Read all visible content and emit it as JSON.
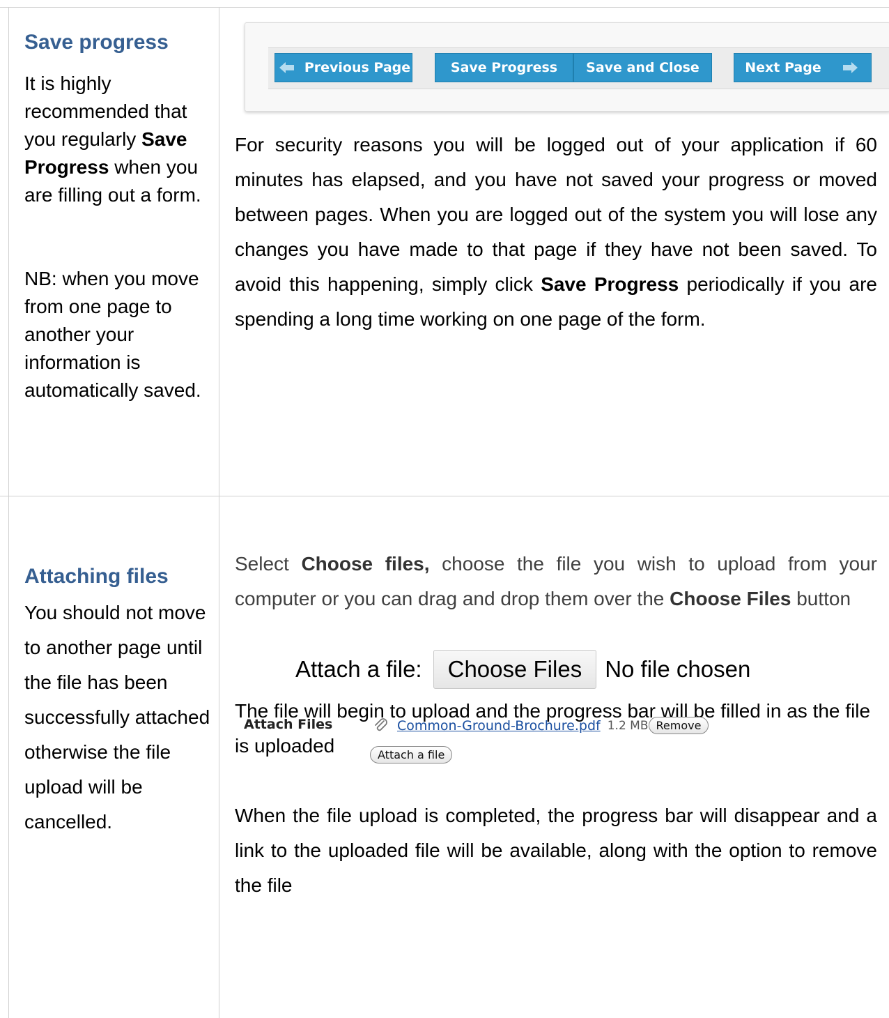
{
  "section1": {
    "heading": "Save progress",
    "side_text_a": "It is highly recommended that you regularly",
    "side_text_bold": "Save Progress",
    "side_text_b": "when you are filling out a form.",
    "side_note": "NB: when you move from one page to another your information is automatically saved.",
    "nav": {
      "prev_label": "Previous Page",
      "save_label": "Save Progress",
      "save_close_label": "Save and Close",
      "next_label": "Next Page"
    },
    "body_a": "For security reasons you will be logged out of your application if 60 minutes has elapsed, and you have not saved your progress or moved between pages. When you are logged out of the system you will lose any changes you have made to that page if they have not been saved. To avoid this happening, simply click",
    "body_bold": "Save Progress",
    "body_b": "periodically if you are spending a long time working on one page of the form."
  },
  "section2": {
    "heading": "Attaching files",
    "side_text": "You should not move to another page until the file has been successfully attached otherwise the file upload will be cancelled.",
    "p1_a": "Select",
    "p1_bold1": "Choose files,",
    "p1_b": "choose the file you wish to upload from your computer or you can drag and drop them over the",
    "p1_bold2": "Choose Files",
    "p1_c": "button",
    "file_input": {
      "label": "Attach a file:",
      "button": "Choose Files",
      "status": "No file chosen"
    },
    "p2": "The file will begin to upload and the progress bar will be filled in as the file is uploaded",
    "p3": "When the file upload is completed, the progress bar will disappear and a link to the uploaded file will be available, along with the option to remove the file",
    "widget": {
      "label": "Attach Files",
      "file_name": "Common-Ground-Brochure.pdf",
      "file_size": "1.2 MB",
      "remove_label": "Remove",
      "attach_label": "Attach a file"
    }
  }
}
